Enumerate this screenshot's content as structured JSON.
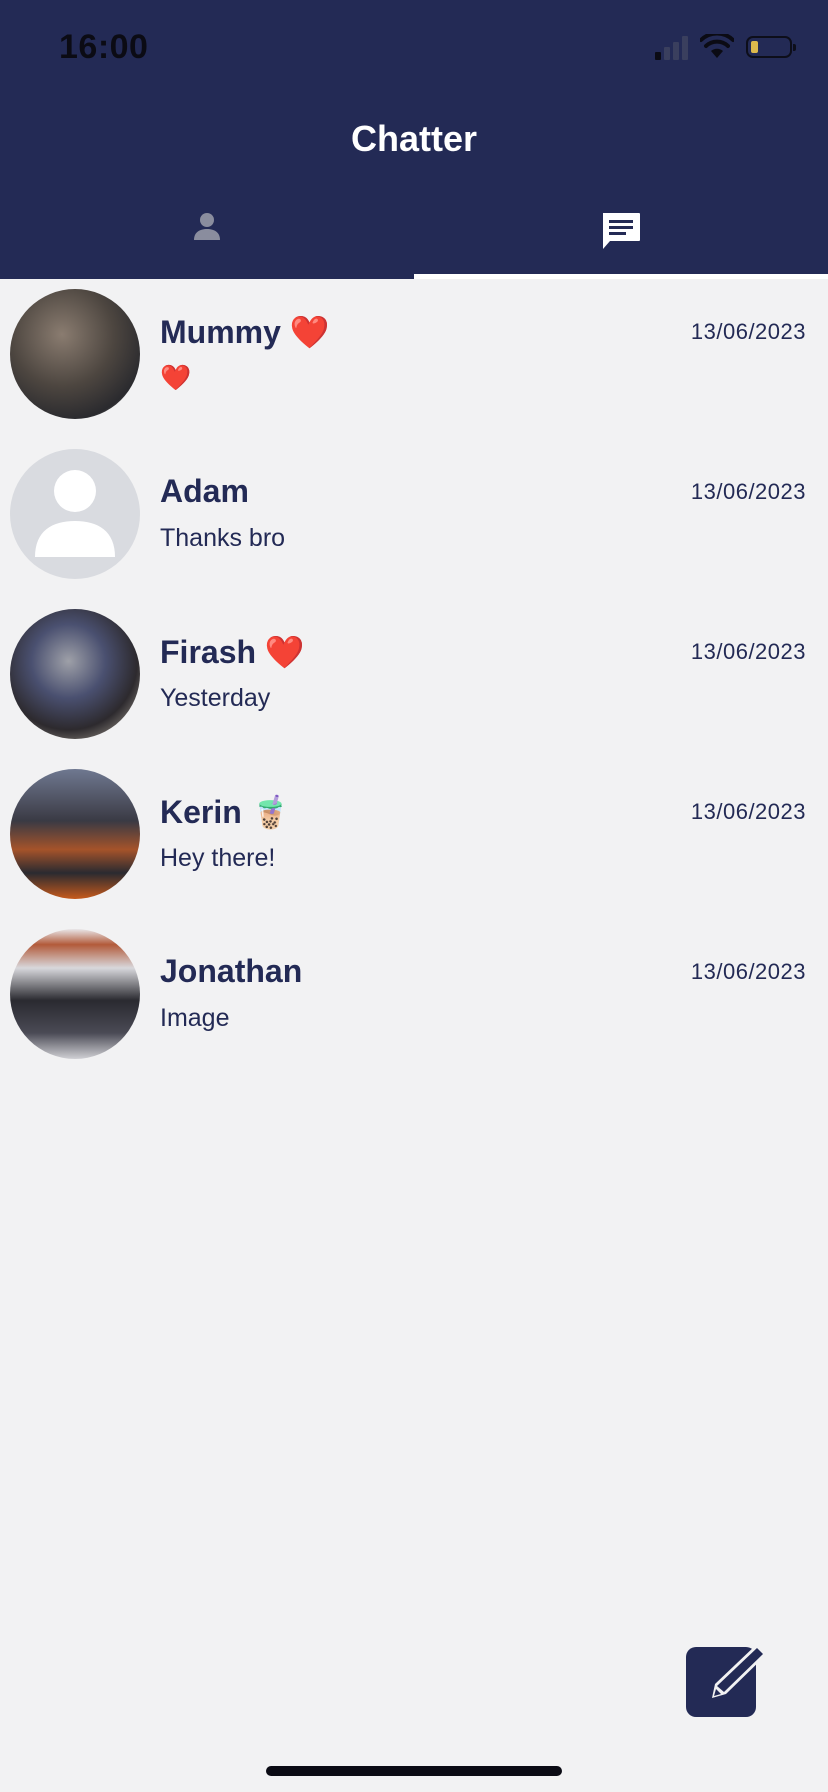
{
  "status_bar": {
    "time": "16:00"
  },
  "header": {
    "title": "Chatter",
    "background_color": "#232a55"
  },
  "tabs": [
    {
      "label": "Contacts",
      "icon": "person-icon",
      "selected": false
    },
    {
      "label": "Chats",
      "icon": "chat-icon",
      "selected": true
    }
  ],
  "chats": [
    {
      "name": "Mummy ❤️",
      "preview": "❤️",
      "date": "13/06/2023",
      "avatar": "photo"
    },
    {
      "name": "Adam",
      "preview": "Thanks bro",
      "date": "13/06/2023",
      "avatar": "placeholder"
    },
    {
      "name": "Firash ❤️",
      "preview": "Yesterday",
      "date": "13/06/2023",
      "avatar": "photo"
    },
    {
      "name": "Kerin 🧋",
      "preview": "Hey there!",
      "date": "13/06/2023",
      "avatar": "photo"
    },
    {
      "name": "Jonathan",
      "preview": "Image",
      "date": "13/06/2023",
      "avatar": "photo"
    }
  ],
  "compose": {
    "icon": "compose-icon"
  },
  "colors": {
    "primary": "#232a55",
    "background": "#f2f2f3"
  }
}
